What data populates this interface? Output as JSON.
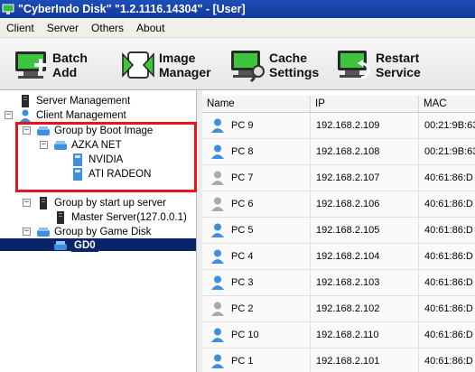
{
  "window": {
    "title": "\"CyberIndo Disk\" \"1.2.1116.14304\" - [User]"
  },
  "menu": [
    "Client",
    "Server",
    "Others",
    "About"
  ],
  "toolbar": {
    "batch_add": [
      "Batch",
      "Add"
    ],
    "image_manager": [
      "Image",
      "Manager"
    ],
    "cache_settings": [
      "Cache",
      "Settings"
    ],
    "restart_service": [
      "Restart",
      "Service"
    ]
  },
  "tree": {
    "server_management": "Server Management",
    "client_management": "Client Management",
    "group_boot_image": "Group by Boot Image",
    "azka_net": "AZKA NET",
    "nvidia": "NVIDIA",
    "ati_radeon": "ATI RADEON",
    "group_startup_server": "Group by start up server",
    "master_server": "Master Server(127.0.0.1)",
    "group_game_disk": "Group by Game Disk",
    "gd0": "GD0"
  },
  "table": {
    "columns": [
      "Name",
      "IP",
      "MAC"
    ],
    "rows": [
      {
        "name": "PC 9",
        "ip": "192.168.2.109",
        "mac": "00:21:9B:63",
        "online": true
      },
      {
        "name": "PC 8",
        "ip": "192.168.2.108",
        "mac": "00:21:9B:63",
        "online": true
      },
      {
        "name": "PC 7",
        "ip": "192.168.2.107",
        "mac": "40:61:86:D",
        "online": false
      },
      {
        "name": "PC 6",
        "ip": "192.168.2.106",
        "mac": "40:61:86:D",
        "online": false
      },
      {
        "name": "PC 5",
        "ip": "192.168.2.105",
        "mac": "40:61:86:D",
        "online": true
      },
      {
        "name": "PC 4",
        "ip": "192.168.2.104",
        "mac": "40:61:86:D",
        "online": true
      },
      {
        "name": "PC 3",
        "ip": "192.168.2.103",
        "mac": "40:61:86:D",
        "online": true
      },
      {
        "name": "PC 2",
        "ip": "192.168.2.102",
        "mac": "40:61:86:D",
        "online": false
      },
      {
        "name": "PC 10",
        "ip": "192.168.2.110",
        "mac": "40:61:86:D",
        "online": true
      },
      {
        "name": "PC 1",
        "ip": "192.168.2.101",
        "mac": "40:61:86:D",
        "online": true
      }
    ]
  },
  "colors": {
    "online": "#3f8fe0",
    "offline": "#a9a9a9",
    "highlight": "#e8131d",
    "selection": "#0a246a"
  }
}
